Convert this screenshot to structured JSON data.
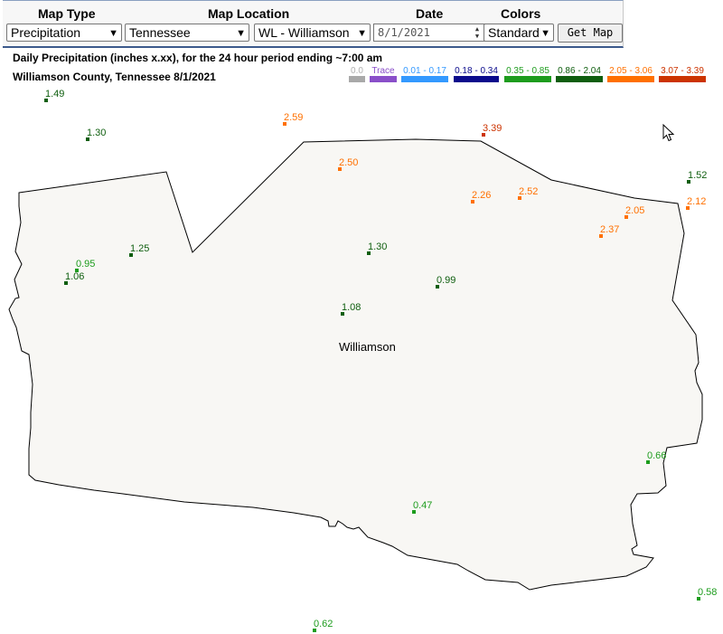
{
  "controls": {
    "labels": {
      "map_type": "Map Type",
      "map_location": "Map Location",
      "date": "Date",
      "colors": "Colors"
    },
    "map_type_value": "Precipitation",
    "location_state_value": "Tennessee",
    "location_county_value": "WL - Williamson",
    "date_value": "8/1/2021",
    "colors_value": "Standard",
    "get_map_label": "Get Map"
  },
  "header": {
    "title": "Daily Precipitation (inches  x.xx),  for the 24 hour period ending ~7:00 am",
    "subtitle": "Williamson County, Tennessee  8/1/2021"
  },
  "legend": [
    {
      "label": "0.0",
      "color": "#a9a9a9",
      "text_color": "#b0b0b0"
    },
    {
      "label": "Trace",
      "color": "#8a4fc9",
      "text_color": "#8a4fc9"
    },
    {
      "label": "0.01 - 0.17",
      "color": "#3399ff",
      "text_color": "#3399ff"
    },
    {
      "label": "0.18 - 0.34",
      "color": "#0a0a8c",
      "text_color": "#0a0a8c"
    },
    {
      "label": "0.35 - 0.85",
      "color": "#1d9c1d",
      "text_color": "#1d9c1d"
    },
    {
      "label": "0.86 - 2.04",
      "color": "#0e5e0e",
      "text_color": "#0e5e0e"
    },
    {
      "label": "2.05 - 3.06",
      "color": "#ff7000",
      "text_color": "#ff7000"
    },
    {
      "label": "3.07 - 3.39",
      "color": "#cc3300",
      "text_color": "#cc3300"
    }
  ],
  "map": {
    "county_name": "Williamson",
    "county_fill": "#f8f7f4",
    "stations": [
      {
        "value": "1.49",
        "color": "#0e5e0e"
      },
      {
        "value": "1.30",
        "color": "#0e5e0e"
      },
      {
        "value": "2.59",
        "color": "#ff7000"
      },
      {
        "value": "3.39",
        "color": "#cc3300"
      },
      {
        "value": "2.50",
        "color": "#ff7000"
      },
      {
        "value": "1.52",
        "color": "#0e5e0e"
      },
      {
        "value": "2.26",
        "color": "#ff7000"
      },
      {
        "value": "2.52",
        "color": "#ff7000"
      },
      {
        "value": "2.12",
        "color": "#ff7000"
      },
      {
        "value": "2.05",
        "color": "#ff7000"
      },
      {
        "value": "2.37",
        "color": "#ff7000"
      },
      {
        "value": "1.25",
        "color": "#0e5e0e"
      },
      {
        "value": "1.30",
        "color": "#0e5e0e"
      },
      {
        "value": "0.95",
        "color": "#1d9c1d"
      },
      {
        "value": "1.06",
        "color": "#0e5e0e"
      },
      {
        "value": "0.99",
        "color": "#0e5e0e"
      },
      {
        "value": "1.08",
        "color": "#0e5e0e"
      },
      {
        "value": "0.66",
        "color": "#1d9c1d"
      },
      {
        "value": "0.47",
        "color": "#1d9c1d"
      },
      {
        "value": "0.58",
        "color": "#1d9c1d"
      },
      {
        "value": "0.62",
        "color": "#1d9c1d"
      }
    ]
  }
}
